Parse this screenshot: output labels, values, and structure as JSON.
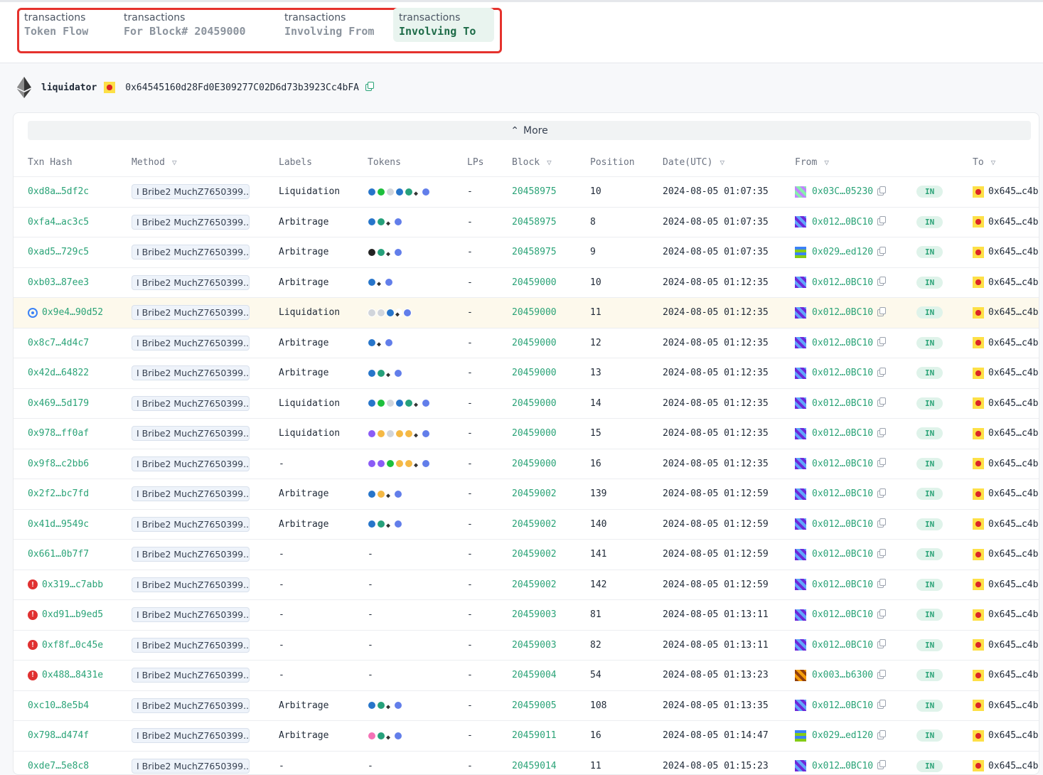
{
  "tabs": [
    {
      "sup": "transactions",
      "main": "Token Flow"
    },
    {
      "sup": "transactions",
      "main": "For Block# 20459000"
    },
    {
      "sup": "transactions",
      "main": "Involving From"
    },
    {
      "sup": "transactions",
      "main": "Involving To"
    }
  ],
  "active_tab": "Involving To",
  "owner": {
    "name": "liquidator",
    "address": "0x64545160d28Fd0E309277C02D6d73b3923Cc4bFA"
  },
  "more_label": "More",
  "columns": [
    "Txn Hash",
    "Method",
    "Labels",
    "Tokens",
    "LPs",
    "Block",
    "Position",
    "Date(UTC)",
    "From",
    "To"
  ],
  "rows": [
    {
      "hash": "0xd8a…5df2c",
      "method": "I Bribe2 MuchZ7650399...",
      "label": "Liquidation",
      "tokens": [
        "usdc",
        "grn",
        "gry",
        "usdc",
        "usdt",
        "eth",
        "weth"
      ],
      "lps": "-",
      "block": "20458975",
      "position": "10",
      "date": "2024-08-05 01:07:35",
      "from": "0x03C…05230",
      "from_av": "pink",
      "dir": "IN",
      "to": "0x645…c4b",
      "flag": ""
    },
    {
      "hash": "0xfa4…ac3c5",
      "method": "I Bribe2 MuchZ7650399...",
      "label": "Arbitrage",
      "tokens": [
        "usdc",
        "usdt",
        "eth",
        "weth"
      ],
      "lps": "-",
      "block": "20458975",
      "position": "8",
      "date": "2024-08-05 01:07:35",
      "from": "0x012…0BC10",
      "from_av": "purple",
      "dir": "IN",
      "to": "0x645…c4b",
      "flag": ""
    },
    {
      "hash": "0xad5…729c5",
      "method": "I Bribe2 MuchZ7650399...",
      "label": "Arbitrage",
      "tokens": [
        "blk",
        "usdt",
        "eth",
        "weth"
      ],
      "lps": "-",
      "block": "20458975",
      "position": "9",
      "date": "2024-08-05 01:07:35",
      "from": "0x029…ed120",
      "from_av": "green",
      "dir": "IN",
      "to": "0x645…c4b",
      "flag": ""
    },
    {
      "hash": "0xb03…87ee3",
      "method": "I Bribe2 MuchZ7650399...",
      "label": "Arbitrage",
      "tokens": [
        "usdc",
        "eth",
        "weth"
      ],
      "lps": "-",
      "block": "20459000",
      "position": "10",
      "date": "2024-08-05 01:12:35",
      "from": "0x012…0BC10",
      "from_av": "purple",
      "dir": "IN",
      "to": "0x645…c4b",
      "flag": ""
    },
    {
      "hash": "0x9e4…90d52",
      "method": "I Bribe2 MuchZ7650399...",
      "label": "Liquidation",
      "tokens": [
        "gry",
        "gry",
        "usdc",
        "eth",
        "weth"
      ],
      "lps": "-",
      "block": "20459000",
      "position": "11",
      "date": "2024-08-05 01:12:35",
      "from": "0x012…0BC10",
      "from_av": "purple",
      "dir": "IN",
      "to": "0x645…c4b",
      "flag": "loc"
    },
    {
      "hash": "0x8c7…4d4c7",
      "method": "I Bribe2 MuchZ7650399...",
      "label": "Arbitrage",
      "tokens": [
        "usdc",
        "eth",
        "weth"
      ],
      "lps": "-",
      "block": "20459000",
      "position": "12",
      "date": "2024-08-05 01:12:35",
      "from": "0x012…0BC10",
      "from_av": "purple",
      "dir": "IN",
      "to": "0x645…c4b",
      "flag": ""
    },
    {
      "hash": "0x42d…64822",
      "method": "I Bribe2 MuchZ7650399...",
      "label": "Arbitrage",
      "tokens": [
        "usdc",
        "usdt",
        "eth",
        "weth"
      ],
      "lps": "-",
      "block": "20459000",
      "position": "13",
      "date": "2024-08-05 01:12:35",
      "from": "0x012…0BC10",
      "from_av": "purple",
      "dir": "IN",
      "to": "0x645…c4b",
      "flag": ""
    },
    {
      "hash": "0x469…5d179",
      "method": "I Bribe2 MuchZ7650399...",
      "label": "Liquidation",
      "tokens": [
        "usdc",
        "grn",
        "gry",
        "usdc",
        "usdt",
        "eth",
        "weth"
      ],
      "lps": "-",
      "block": "20459000",
      "position": "14",
      "date": "2024-08-05 01:12:35",
      "from": "0x012…0BC10",
      "from_av": "purple",
      "dir": "IN",
      "to": "0x645…c4b",
      "flag": ""
    },
    {
      "hash": "0x978…ff0af",
      "method": "I Bribe2 MuchZ7650399...",
      "label": "Liquidation",
      "tokens": [
        "pur",
        "org",
        "gry",
        "org",
        "org",
        "eth",
        "weth"
      ],
      "lps": "-",
      "block": "20459000",
      "position": "15",
      "date": "2024-08-05 01:12:35",
      "from": "0x012…0BC10",
      "from_av": "purple",
      "dir": "IN",
      "to": "0x645…c4b",
      "flag": ""
    },
    {
      "hash": "0x9f8…c2bb6",
      "method": "I Bribe2 MuchZ7650399...",
      "label": "-",
      "tokens": [
        "pur",
        "pur",
        "grn",
        "org",
        "org",
        "eth",
        "weth"
      ],
      "lps": "-",
      "block": "20459000",
      "position": "16",
      "date": "2024-08-05 01:12:35",
      "from": "0x012…0BC10",
      "from_av": "purple",
      "dir": "IN",
      "to": "0x645…c4b",
      "flag": ""
    },
    {
      "hash": "0x2f2…bc7fd",
      "method": "I Bribe2 MuchZ7650399...",
      "label": "Arbitrage",
      "tokens": [
        "usdc",
        "org",
        "eth",
        "weth"
      ],
      "lps": "-",
      "block": "20459002",
      "position": "139",
      "date": "2024-08-05 01:12:59",
      "from": "0x012…0BC10",
      "from_av": "purple",
      "dir": "IN",
      "to": "0x645…c4b",
      "flag": ""
    },
    {
      "hash": "0x41d…9549c",
      "method": "I Bribe2 MuchZ7650399...",
      "label": "Arbitrage",
      "tokens": [
        "usdc",
        "usdt",
        "eth",
        "weth"
      ],
      "lps": "-",
      "block": "20459002",
      "position": "140",
      "date": "2024-08-05 01:12:59",
      "from": "0x012…0BC10",
      "from_av": "purple",
      "dir": "IN",
      "to": "0x645…c4b",
      "flag": ""
    },
    {
      "hash": "0x661…0b7f7",
      "method": "I Bribe2 MuchZ7650399...",
      "label": "-",
      "tokens": [],
      "lps": "-",
      "block": "20459002",
      "position": "141",
      "date": "2024-08-05 01:12:59",
      "from": "0x012…0BC10",
      "from_av": "purple",
      "dir": "IN",
      "to": "0x645…c4b",
      "flag": ""
    },
    {
      "hash": "0x319…c7abb",
      "method": "I Bribe2 MuchZ7650399...",
      "label": "-",
      "tokens": [],
      "lps": "-",
      "block": "20459002",
      "position": "142",
      "date": "2024-08-05 01:12:59",
      "from": "0x012…0BC10",
      "from_av": "purple",
      "dir": "IN",
      "to": "0x645…c4b",
      "flag": "alert"
    },
    {
      "hash": "0xd91…b9ed5",
      "method": "I Bribe2 MuchZ7650399...",
      "label": "-",
      "tokens": [],
      "lps": "-",
      "block": "20459003",
      "position": "81",
      "date": "2024-08-05 01:13:11",
      "from": "0x012…0BC10",
      "from_av": "purple",
      "dir": "IN",
      "to": "0x645…c4b",
      "flag": "alert"
    },
    {
      "hash": "0xf8f…0c45e",
      "method": "I Bribe2 MuchZ7650399...",
      "label": "-",
      "tokens": [],
      "lps": "-",
      "block": "20459003",
      "position": "82",
      "date": "2024-08-05 01:13:11",
      "from": "0x012…0BC10",
      "from_av": "purple",
      "dir": "IN",
      "to": "0x645…c4b",
      "flag": "alert"
    },
    {
      "hash": "0x488…8431e",
      "method": "I Bribe2 MuchZ7650399...",
      "label": "-",
      "tokens": [],
      "lps": "-",
      "block": "20459004",
      "position": "54",
      "date": "2024-08-05 01:13:23",
      "from": "0x003…b6300",
      "from_av": "brown",
      "dir": "IN",
      "to": "0x645…c4b",
      "flag": "alert"
    },
    {
      "hash": "0xc10…8e5b4",
      "method": "I Bribe2 MuchZ7650399...",
      "label": "Arbitrage",
      "tokens": [
        "usdc",
        "usdt",
        "eth",
        "weth"
      ],
      "lps": "-",
      "block": "20459005",
      "position": "108",
      "date": "2024-08-05 01:13:35",
      "from": "0x012…0BC10",
      "from_av": "purple",
      "dir": "IN",
      "to": "0x645…c4b",
      "flag": ""
    },
    {
      "hash": "0x798…d474f",
      "method": "I Bribe2 MuchZ7650399...",
      "label": "Arbitrage",
      "tokens": [
        "pnk",
        "usdt",
        "eth",
        "weth"
      ],
      "lps": "-",
      "block": "20459011",
      "position": "16",
      "date": "2024-08-05 01:14:47",
      "from": "0x029…ed120",
      "from_av": "green",
      "dir": "IN",
      "to": "0x645…c4b",
      "flag": ""
    },
    {
      "hash": "0xde7…5e8c8",
      "method": "I Bribe2 MuchZ7650399...",
      "label": "-",
      "tokens": [],
      "lps": "-",
      "block": "20459014",
      "position": "11",
      "date": "2024-08-05 01:15:23",
      "from": "0x012…0BC10",
      "from_av": "purple",
      "dir": "IN",
      "to": "0x645…c4b",
      "flag": ""
    }
  ],
  "colors": {
    "accent_green": "#2aa377",
    "highlight_box": "#e5322d",
    "active_tab_bg": "#e9f4ef"
  }
}
